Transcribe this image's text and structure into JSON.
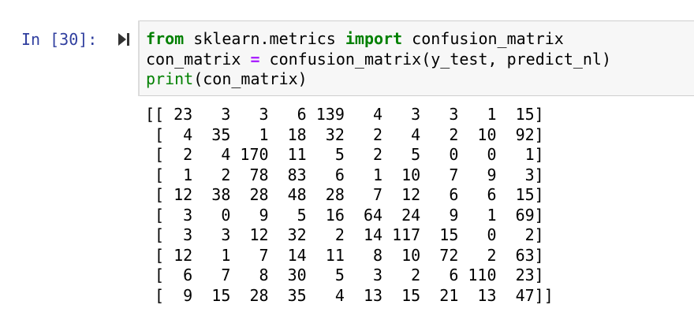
{
  "cell": {
    "prompt": "In [30]:",
    "code": {
      "line1": {
        "kw_from": "from",
        "module": " sklearn.metrics ",
        "kw_import": "import",
        "name": " confusion_matrix"
      },
      "line2": {
        "var": "con_matrix ",
        "op": "=",
        "call": " confusion_matrix(y_test, predict_nl)"
      },
      "line3": {
        "builtin": "print",
        "args": "(con_matrix)"
      }
    },
    "output_lines": [
      "[[ 23   3   3   6 139   4   3   3   1  15]",
      " [  4  35   1  18  32   2   4   2  10  92]",
      " [  2   4 170  11   5   2   5   0   0   1]",
      " [  1   2  78  83   6   1  10   7   9   3]",
      " [ 12  38  28  48  28   7  12   6   6  15]",
      " [  3   0   9   5  16  64  24   9   1  69]",
      " [  3   3  12  32   2  14 117  15   0   2]",
      " [ 12   1   7  14  11   8  10  72   2  63]",
      " [  6   7   8  30   5   3   2   6 110  23]",
      " [  9  15  28  35   4  13  15  21  13  47]]"
    ]
  },
  "colors": {
    "prompt": "#303f9f",
    "keyword": "#008000",
    "operator": "#aa22ff",
    "input_bg": "#f7f7f7",
    "input_border": "#cfcfcf"
  },
  "icons": {
    "run": "run-cell-icon"
  }
}
